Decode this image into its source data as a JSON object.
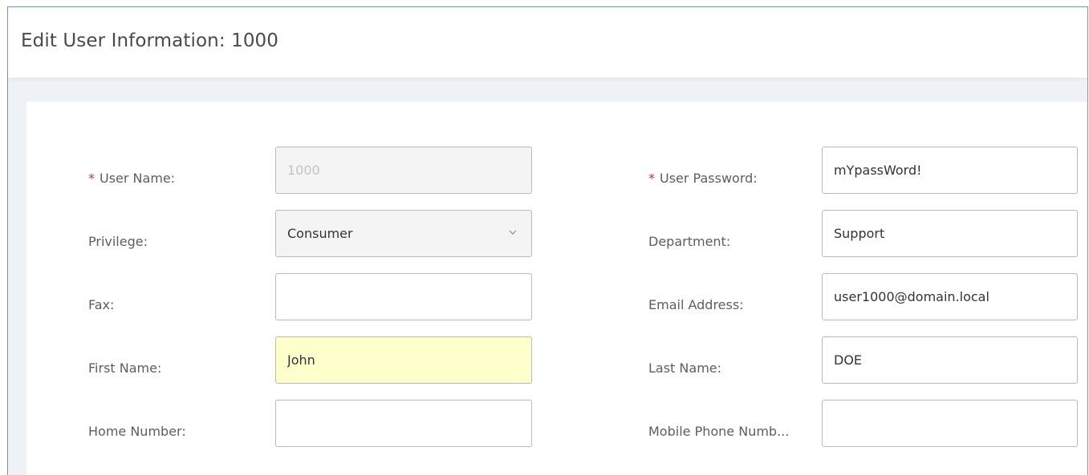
{
  "header": {
    "title": "Edit User Information: 1000"
  },
  "form": {
    "user_name": {
      "label": "User Name:",
      "value": "1000"
    },
    "privilege": {
      "label": "Privilege:",
      "value": "Consumer"
    },
    "fax": {
      "label": "Fax:",
      "value": ""
    },
    "first_name": {
      "label": "First Name:",
      "value": "John"
    },
    "home_number": {
      "label": "Home Number:",
      "value": ""
    },
    "user_password": {
      "label": "User Password:",
      "value": "mYpassWord!"
    },
    "department": {
      "label": "Department:",
      "value": "Support"
    },
    "email_address": {
      "label": "Email Address:",
      "value": "user1000@domain.local"
    },
    "last_name": {
      "label": "Last Name:",
      "value": "DOE"
    },
    "mobile_phone": {
      "label": "Mobile Phone Numb...",
      "value": ""
    }
  },
  "required_marker": "*",
  "colors": {
    "frame_border": "#5b9bd5",
    "required": "#c0392b",
    "highlight_field": "#ffffcc",
    "disabled_field": "#f4f4f4"
  },
  "icons": {
    "privilege_dropdown": "chevron-down-icon"
  }
}
